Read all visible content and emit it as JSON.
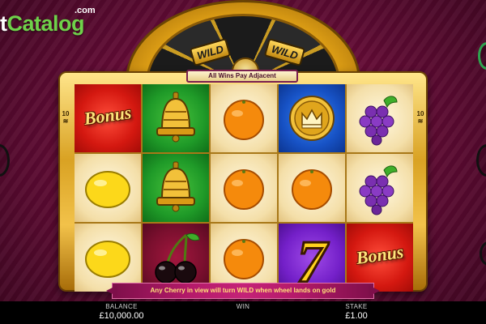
{
  "watermark": {
    "text_prefix": "t",
    "text_brand": "Catalog",
    "text_suffix": ".com"
  },
  "wheel": {
    "labels": [
      "WILD",
      "WILD"
    ]
  },
  "top_banner": "All Wins Pay Adjacent",
  "side_markers": {
    "left": "10\n☰",
    "right": "10\n☰"
  },
  "reels": [
    [
      "bonus",
      "bell",
      "orange",
      "crown",
      "grapes"
    ],
    [
      "lemon",
      "bell",
      "orange",
      "orange",
      "grapes"
    ],
    [
      "lemon",
      "cherry",
      "orange",
      "seven",
      "bonus"
    ]
  ],
  "symbol_text": {
    "bonus": "Bonus",
    "seven": "7"
  },
  "bottom_banner": "Any Cherry in view will turn WILD when wheel lands on gold",
  "status": {
    "balance_label": "BALANCE",
    "balance_value": "£10,000.00",
    "win_label": "WIN",
    "win_value": "",
    "stake_label": "STAKE",
    "stake_value": "£1.00"
  },
  "colors": {
    "background": "#5e0b33",
    "frame_gold": "#d9a223",
    "bonus_bg": "#d41810",
    "bell_bg": "#1f9a28",
    "crown_bg": "#1752c5",
    "cherry_bg": "#7a0f2e",
    "seven_bg": "#7420c9",
    "banner": "#b51a6a"
  }
}
